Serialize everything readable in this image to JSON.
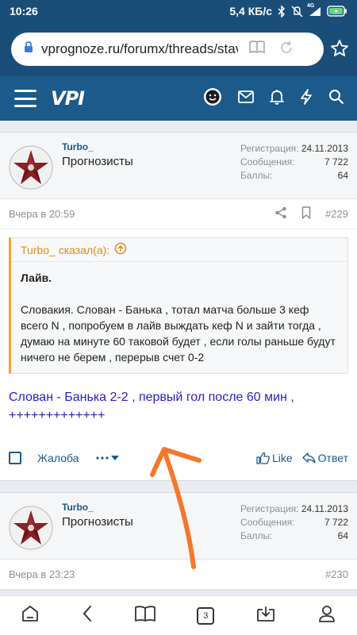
{
  "status_bar": {
    "time": "10:26",
    "speed": "5,4 КБ/с",
    "network": "4G"
  },
  "browser": {
    "url": "vprognoze.ru/forumx/threads/stav"
  },
  "site": {
    "logo": "VPI"
  },
  "posts": [
    {
      "username": "Turbo_",
      "usertitle": "Прогнозисты",
      "stats": [
        {
          "label": "Регистрация:",
          "value": "24.11.2013"
        },
        {
          "label": "Сообщения:",
          "value": "7 722"
        },
        {
          "label": "Баллы:",
          "value": "64"
        }
      ],
      "date": "Вчера в 20:59",
      "number": "#229",
      "quote_author": "Turbo_ сказал(а):",
      "quote_title": "Лайв.",
      "quote_text": "Словакия. Слован - Банька , тотал матча больше 3 кеф всего N , попробуем в лайв выждать кеф N и зайти тогда , думаю на минуте 60 таковой будет , если голы раньше будут ничего не берем , перерыв счет 0-2",
      "text": "Слован - Банька 2-2 , первый гол после 60 мин , +++++++++++++",
      "report": "Жалоба",
      "like": "Like",
      "reply": "Ответ"
    },
    {
      "username": "Turbo_",
      "usertitle": "Прогнозисты",
      "stats": [
        {
          "label": "Регистрация:",
          "value": "24.11.2013"
        },
        {
          "label": "Сообщения:",
          "value": "7 722"
        },
        {
          "label": "Баллы:",
          "value": "64"
        }
      ],
      "date": "Вчера в 23:23",
      "number": "#230"
    }
  ],
  "bottom_nav": {
    "tabs_count": "3"
  },
  "colors": {
    "header": "#1b5a8b",
    "accent_orange": "#f5772b",
    "quote_border": "#f0a330",
    "post_text": "#2a1ec5"
  }
}
